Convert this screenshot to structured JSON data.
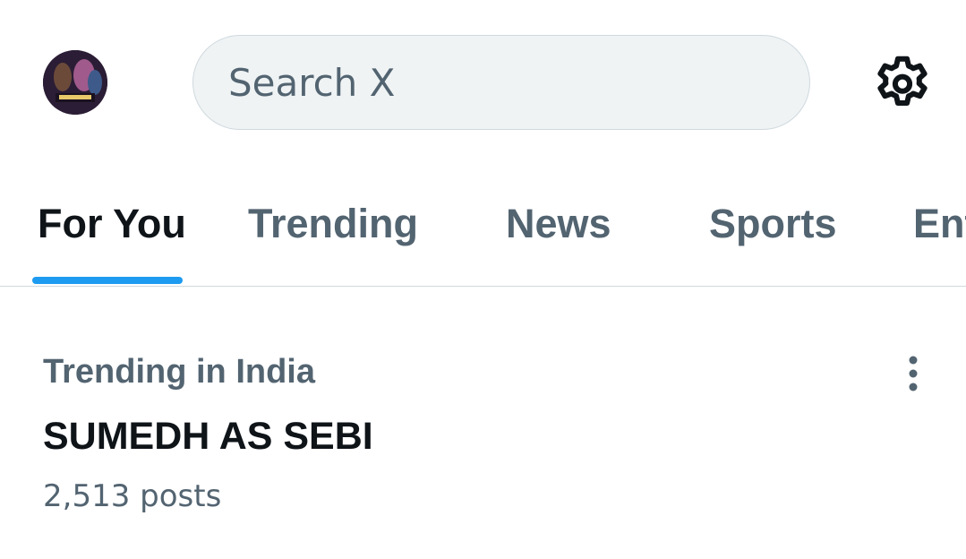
{
  "header": {
    "avatar_icon": "user-avatar",
    "search": {
      "placeholder": "Search X",
      "value": ""
    },
    "settings_icon": "gear-icon"
  },
  "tabs": [
    {
      "label": "For You",
      "active": true
    },
    {
      "label": "Trending",
      "active": false
    },
    {
      "label": "News",
      "active": false
    },
    {
      "label": "Sports",
      "active": false
    },
    {
      "label": "Ent",
      "active": false
    }
  ],
  "trend": {
    "context": "Trending in India",
    "name": "SUMEDH AS SEBI",
    "count": "2,513 posts",
    "more_icon": "more-vertical-icon"
  },
  "colors": {
    "accent": "#1d9bf0",
    "primary_text": "#0f1419",
    "secondary_text": "#536471",
    "search_bg": "#eff3f4",
    "border": "#cfd9de"
  }
}
